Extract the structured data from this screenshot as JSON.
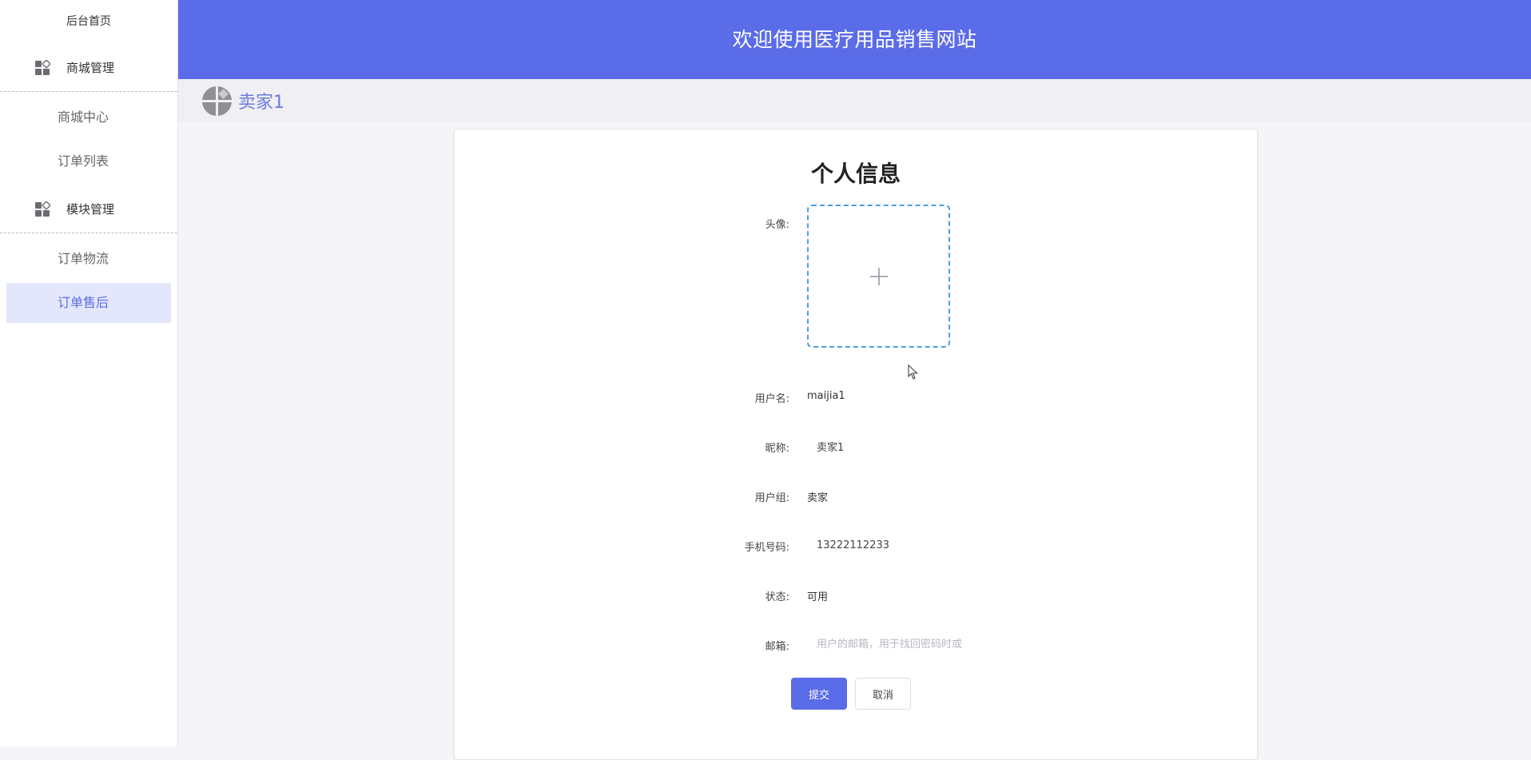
{
  "sidebar": {
    "home": "后台首页",
    "groups": [
      {
        "label": "商城管理",
        "icon": "grid-icon",
        "items": [
          {
            "label": "商城中心"
          },
          {
            "label": "订单列表"
          }
        ]
      },
      {
        "label": "模块管理",
        "icon": "grid-icon",
        "items": [
          {
            "label": "订单物流"
          },
          {
            "label": "订单售后",
            "active": true
          }
        ]
      }
    ]
  },
  "header": {
    "title": "欢迎使用医疗用品销售网站"
  },
  "subheader": {
    "username": "卖家1",
    "avatar_icon": "avatar-icon"
  },
  "form": {
    "title": "个人信息",
    "avatar_label": "头像:",
    "upload_icon": "plus-icon",
    "username_label": "用户名:",
    "username_value": "maijia1",
    "nickname_label": "昵称:",
    "nickname_value": "卖家1",
    "group_label": "用户组:",
    "group_value": "卖家",
    "phone_label": "手机号码:",
    "phone_value": "13222112233",
    "status_label": "状态:",
    "status_value": "可用",
    "email_label": "邮箱:",
    "email_placeholder": "用户的邮箱，用于找回密码时或",
    "submit_label": "提交",
    "cancel_label": "取消"
  },
  "colors": {
    "accent": "#5b6ce8",
    "header_bg": "#5b6ce8",
    "active_item_bg": "#e4e7fb",
    "active_item_text": "#5b6ce6",
    "upload_border": "#4d9be8"
  }
}
